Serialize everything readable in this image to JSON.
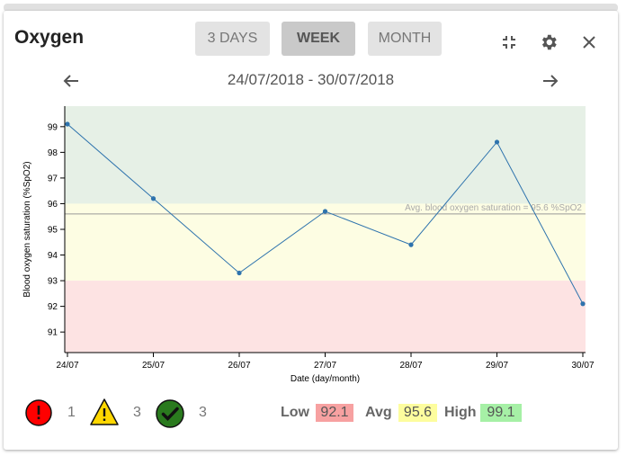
{
  "header": {
    "title": "Oxygen",
    "ranges": [
      "3 DAYS",
      "WEEK",
      "MONTH"
    ],
    "active_range": "WEEK"
  },
  "icons": {
    "collapse": "collapse-icon",
    "settings": "gear-icon",
    "close": "close-icon",
    "prev": "arrow-left-icon",
    "next": "arrow-right-icon"
  },
  "nav": {
    "date_range": "24/07/2018 - 30/07/2018"
  },
  "chart_data": {
    "type": "line",
    "x": [
      "24/07",
      "25/07",
      "26/07",
      "27/07",
      "28/07",
      "29/07",
      "30/07"
    ],
    "values": [
      99.1,
      96.2,
      93.3,
      95.7,
      94.4,
      98.4,
      92.1
    ],
    "xlabel": "Date (day/month)",
    "ylabel": "Blood oxygen saturation (%SpO2)",
    "ylim": [
      90.2,
      99.8
    ],
    "yticks": [
      91,
      92,
      93,
      94,
      95,
      96,
      97,
      98,
      99
    ],
    "bands": [
      {
        "from": 96,
        "to": 99.8,
        "color": "#e6f0e6"
      },
      {
        "from": 93,
        "to": 96,
        "color": "#fdfde3"
      },
      {
        "from": 90.2,
        "to": 93,
        "color": "#fde3e3"
      }
    ],
    "average": 95.6,
    "average_label": "Avg. blood oxygen saturation = 95.6 %SpO2",
    "line_color": "#2e73ad",
    "grid": false
  },
  "legend": {
    "alert_count": "1",
    "warning_count": "3",
    "ok_count": "3"
  },
  "stats": {
    "low_label": "Low",
    "low_value": "92.1",
    "low_color": "#f7a1a1",
    "avg_label": "Avg",
    "avg_value": "95.6",
    "avg_color": "#fdfd9e",
    "high_label": "High",
    "high_value": "99.1",
    "high_color": "#a6f0a6"
  }
}
